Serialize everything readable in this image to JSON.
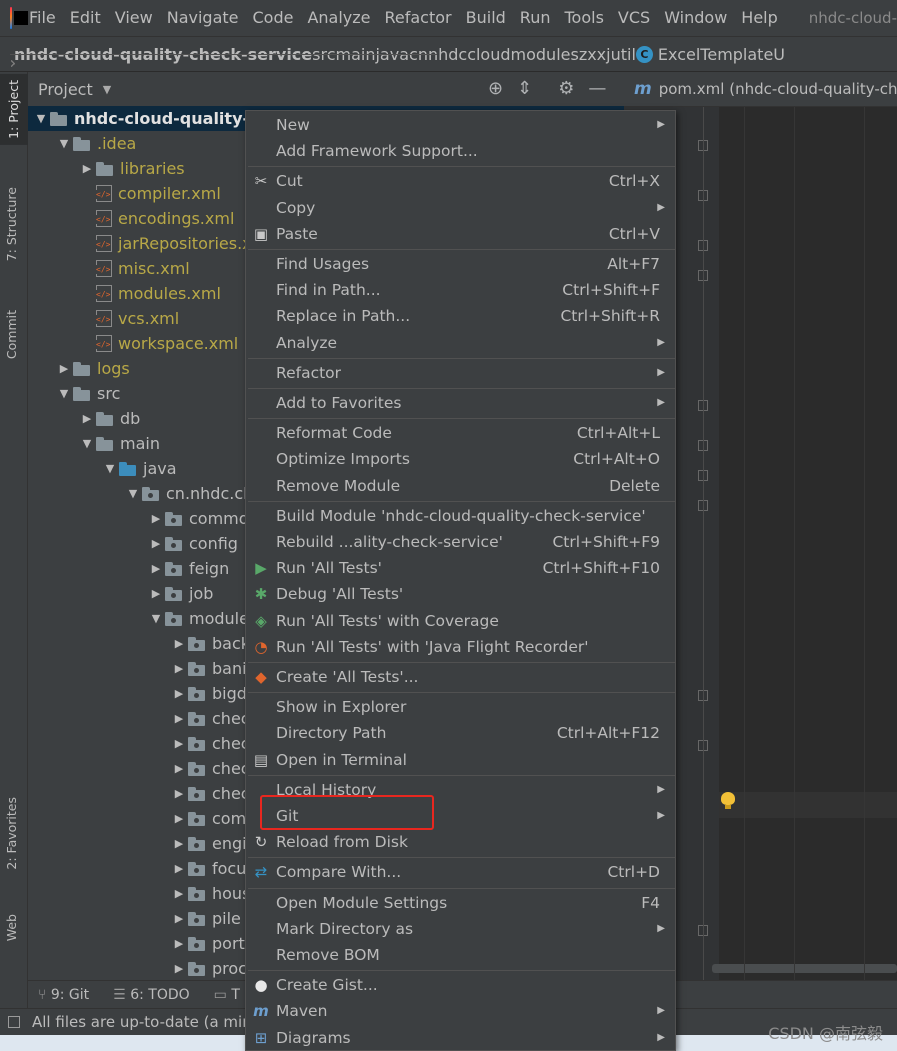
{
  "menubar": {
    "items": [
      "File",
      "Edit",
      "View",
      "Navigate",
      "Code",
      "Analyze",
      "Refactor",
      "Build",
      "Run",
      "Tools",
      "VCS",
      "Window",
      "Help"
    ],
    "window_title": "nhdc-cloud-"
  },
  "breadcrumbs": [
    "nhdc-cloud-quality-check-service",
    "src",
    "main",
    "java",
    "cn",
    "nhdc",
    "cloud",
    "modules",
    "zxxj",
    "util",
    "ExcelTemplateU"
  ],
  "left_strip": {
    "project": "1: Project",
    "structure": "7: Structure",
    "commit": "Commit",
    "favorites": "2: Favorites",
    "web": "Web"
  },
  "project_panel": {
    "title": "Project",
    "tree": [
      {
        "label": "nhdc-cloud-quality-ch",
        "depth": 0,
        "arrow": "down",
        "icon": "folder",
        "style": "bold",
        "selected": true
      },
      {
        "label": ".idea",
        "depth": 1,
        "arrow": "down",
        "icon": "folder",
        "style": "ylw"
      },
      {
        "label": "libraries",
        "depth": 2,
        "arrow": "right",
        "icon": "folder",
        "style": "ylw"
      },
      {
        "label": "compiler.xml",
        "depth": 2,
        "arrow": "",
        "icon": "xml",
        "style": "ylw"
      },
      {
        "label": "encodings.xml",
        "depth": 2,
        "arrow": "",
        "icon": "xml",
        "style": "ylw"
      },
      {
        "label": "jarRepositories.x",
        "depth": 2,
        "arrow": "",
        "icon": "xml",
        "style": "ylw"
      },
      {
        "label": "misc.xml",
        "depth": 2,
        "arrow": "",
        "icon": "xml",
        "style": "ylw"
      },
      {
        "label": "modules.xml",
        "depth": 2,
        "arrow": "",
        "icon": "xml",
        "style": "ylw"
      },
      {
        "label": "vcs.xml",
        "depth": 2,
        "arrow": "",
        "icon": "xml",
        "style": "ylw"
      },
      {
        "label": "workspace.xml",
        "depth": 2,
        "arrow": "",
        "icon": "xml",
        "style": "ylw"
      },
      {
        "label": "logs",
        "depth": 1,
        "arrow": "right",
        "icon": "folder",
        "style": "ylw"
      },
      {
        "label": "src",
        "depth": 1,
        "arrow": "down",
        "icon": "folder",
        "style": "wht"
      },
      {
        "label": "db",
        "depth": 2,
        "arrow": "right",
        "icon": "folder",
        "style": "wht"
      },
      {
        "label": "main",
        "depth": 2,
        "arrow": "down",
        "icon": "folder",
        "style": "wht"
      },
      {
        "label": "java",
        "depth": 3,
        "arrow": "down",
        "icon": "folder-blue",
        "style": "wht"
      },
      {
        "label": "cn.nhdc.clo",
        "depth": 4,
        "arrow": "down",
        "icon": "pkg",
        "style": "wht"
      },
      {
        "label": "commo",
        "depth": 5,
        "arrow": "right",
        "icon": "pkg",
        "style": "wht"
      },
      {
        "label": "config",
        "depth": 5,
        "arrow": "right",
        "icon": "pkg",
        "style": "wht"
      },
      {
        "label": "feign",
        "depth": 5,
        "arrow": "right",
        "icon": "pkg",
        "style": "wht"
      },
      {
        "label": "job",
        "depth": 5,
        "arrow": "right",
        "icon": "pkg",
        "style": "wht"
      },
      {
        "label": "module",
        "depth": 5,
        "arrow": "down",
        "icon": "pkg",
        "style": "wht"
      },
      {
        "label": "back",
        "depth": 6,
        "arrow": "right",
        "icon": "pkg",
        "style": "wht"
      },
      {
        "label": "banin",
        "depth": 6,
        "arrow": "right",
        "icon": "pkg",
        "style": "wht"
      },
      {
        "label": "bigd",
        "depth": 6,
        "arrow": "right",
        "icon": "pkg",
        "style": "wht"
      },
      {
        "label": "chec",
        "depth": 6,
        "arrow": "right",
        "icon": "pkg",
        "style": "wht"
      },
      {
        "label": "chec",
        "depth": 6,
        "arrow": "right",
        "icon": "pkg",
        "style": "wht"
      },
      {
        "label": "chec",
        "depth": 6,
        "arrow": "right",
        "icon": "pkg",
        "style": "wht"
      },
      {
        "label": "chec",
        "depth": 6,
        "arrow": "right",
        "icon": "pkg",
        "style": "wht"
      },
      {
        "label": "comi",
        "depth": 6,
        "arrow": "right",
        "icon": "pkg",
        "style": "wht"
      },
      {
        "label": "engi",
        "depth": 6,
        "arrow": "right",
        "icon": "pkg",
        "style": "wht"
      },
      {
        "label": "focu",
        "depth": 6,
        "arrow": "right",
        "icon": "pkg",
        "style": "wht"
      },
      {
        "label": "hous",
        "depth": 6,
        "arrow": "right",
        "icon": "pkg",
        "style": "wht"
      },
      {
        "label": "pile",
        "depth": 6,
        "arrow": "right",
        "icon": "pkg",
        "style": "wht"
      },
      {
        "label": "porta",
        "depth": 6,
        "arrow": "right",
        "icon": "pkg",
        "style": "wht"
      },
      {
        "label": "proc",
        "depth": 6,
        "arrow": "right",
        "icon": "pkg",
        "style": "wht"
      }
    ]
  },
  "editor": {
    "tab_icon": "m",
    "tab_label": "pom.xml (nhdc-cloud-quality-che"
  },
  "context_menu": [
    {
      "label": "New",
      "shortcut": "",
      "submenu": true,
      "icon": ""
    },
    {
      "label": "Add Framework Support...",
      "shortcut": "",
      "submenu": false,
      "icon": ""
    },
    {
      "sep": true
    },
    {
      "label": "Cut",
      "shortcut": "Ctrl+X",
      "submenu": false,
      "icon": "scissors-icon"
    },
    {
      "label": "Copy",
      "shortcut": "",
      "submenu": true,
      "icon": ""
    },
    {
      "label": "Paste",
      "shortcut": "Ctrl+V",
      "submenu": false,
      "icon": "clipboard-icon"
    },
    {
      "sep": true
    },
    {
      "label": "Find Usages",
      "shortcut": "Alt+F7",
      "submenu": false,
      "icon": ""
    },
    {
      "label": "Find in Path...",
      "shortcut": "Ctrl+Shift+F",
      "submenu": false,
      "icon": ""
    },
    {
      "label": "Replace in Path...",
      "shortcut": "Ctrl+Shift+R",
      "submenu": false,
      "icon": ""
    },
    {
      "label": "Analyze",
      "shortcut": "",
      "submenu": true,
      "icon": ""
    },
    {
      "sep": true
    },
    {
      "label": "Refactor",
      "shortcut": "",
      "submenu": true,
      "icon": ""
    },
    {
      "sep": true
    },
    {
      "label": "Add to Favorites",
      "shortcut": "",
      "submenu": true,
      "icon": ""
    },
    {
      "sep": true
    },
    {
      "label": "Reformat Code",
      "shortcut": "Ctrl+Alt+L",
      "submenu": false,
      "icon": ""
    },
    {
      "label": "Optimize Imports",
      "shortcut": "Ctrl+Alt+O",
      "submenu": false,
      "icon": ""
    },
    {
      "label": "Remove Module",
      "shortcut": "Delete",
      "submenu": false,
      "icon": ""
    },
    {
      "sep": true
    },
    {
      "label": "Build Module 'nhdc-cloud-quality-check-service'",
      "shortcut": "",
      "submenu": false,
      "icon": ""
    },
    {
      "label": "Rebuild ...ality-check-service'",
      "shortcut": "Ctrl+Shift+F9",
      "submenu": false,
      "icon": ""
    },
    {
      "label": "Run 'All Tests'",
      "shortcut": "Ctrl+Shift+F10",
      "submenu": false,
      "icon": "run-icon"
    },
    {
      "label": "Debug 'All Tests'",
      "shortcut": "",
      "submenu": false,
      "icon": "debug-icon"
    },
    {
      "label": "Run 'All Tests' with Coverage",
      "shortcut": "",
      "submenu": false,
      "icon": "coverage-icon"
    },
    {
      "label": "Run 'All Tests' with 'Java Flight Recorder'",
      "shortcut": "",
      "submenu": false,
      "icon": "profiler-icon"
    },
    {
      "sep": true
    },
    {
      "label": "Create 'All Tests'...",
      "shortcut": "",
      "submenu": false,
      "icon": "create-test-icon"
    },
    {
      "sep": true
    },
    {
      "label": "Show in Explorer",
      "shortcut": "",
      "submenu": false,
      "icon": ""
    },
    {
      "label": "Directory Path",
      "shortcut": "Ctrl+Alt+F12",
      "submenu": false,
      "icon": ""
    },
    {
      "label": "Open in Terminal",
      "shortcut": "",
      "submenu": false,
      "icon": "terminal-icon"
    },
    {
      "sep": true
    },
    {
      "label": "Local History",
      "shortcut": "",
      "submenu": true,
      "icon": ""
    },
    {
      "label": "Git",
      "shortcut": "",
      "submenu": true,
      "icon": ""
    },
    {
      "label": "Reload from Disk",
      "shortcut": "",
      "submenu": false,
      "icon": "reload-icon"
    },
    {
      "sep": true
    },
    {
      "label": "Compare With...",
      "shortcut": "Ctrl+D",
      "submenu": false,
      "icon": "compare-icon"
    },
    {
      "sep": true
    },
    {
      "label": "Open Module Settings",
      "shortcut": "F4",
      "submenu": false,
      "icon": ""
    },
    {
      "label": "Mark Directory as",
      "shortcut": "",
      "submenu": true,
      "icon": ""
    },
    {
      "label": "Remove BOM",
      "shortcut": "",
      "submenu": false,
      "icon": ""
    },
    {
      "sep": true
    },
    {
      "label": "Create Gist...",
      "shortcut": "",
      "submenu": false,
      "icon": "github-icon"
    },
    {
      "label": "Maven",
      "shortcut": "",
      "submenu": true,
      "icon": "maven-icon"
    },
    {
      "label": "Diagrams",
      "shortcut": "",
      "submenu": true,
      "icon": "diagram-icon"
    }
  ],
  "bottom_tabs": [
    {
      "label": "9: Git",
      "icon": "git-icon"
    },
    {
      "label": "6: TODO",
      "icon": "todo-icon"
    },
    {
      "label": "T",
      "icon": ""
    }
  ],
  "status": {
    "text": "All files are up-to-date (a min"
  },
  "watermark": "CSDN @南弦毅",
  "colors": {
    "selection": "#0d293e",
    "highlight_box": "#e8271f",
    "panel": "#3c3f41",
    "editor": "#2b2b2b"
  }
}
